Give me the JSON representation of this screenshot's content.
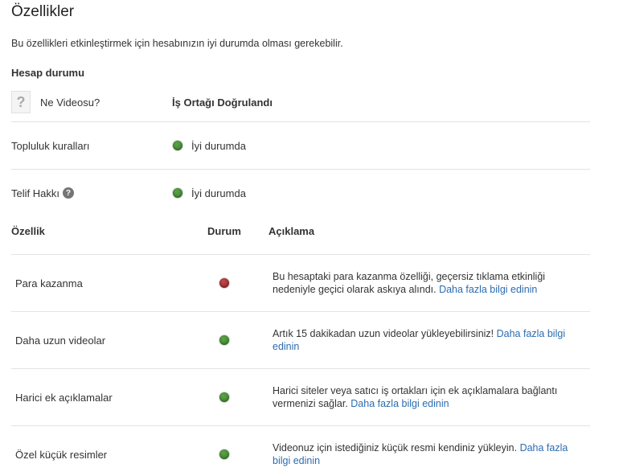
{
  "page": {
    "title": "Özellikler",
    "intro": "Bu özellikleri etkinleştirmek için hesabınızın iyi durumda olması gerekebilir."
  },
  "account_status": {
    "title": "Hesap durumu",
    "rows": [
      {
        "label": "Ne Videosu?",
        "value": "İş Ortağı Doğrulandı"
      },
      {
        "label": "Topluluk kuralları",
        "value": "İyi durumda",
        "status_color": "#3a8a2e"
      },
      {
        "label": "Telif Hakkı",
        "value": "İyi durumda",
        "status_color": "#3a8a2e"
      }
    ]
  },
  "features_table": {
    "headers": {
      "feature": "Özellik",
      "status": "Durum",
      "description": "Açıklama"
    },
    "rows": [
      {
        "name": "Para kazanma",
        "status": "red",
        "text": "Bu hesaptaki para kazanma özelliği, geçersiz tıklama etkinliği nedeniyle geçici olarak askıya alındı.",
        "link": "Daha fazla bilgi edinin"
      },
      {
        "name": "Daha uzun videolar",
        "status": "green",
        "text": "Artık 15 dakikadan uzun videolar yükleyebilirsiniz!",
        "link": "Daha fazla bilgi edinin"
      },
      {
        "name": "Harici ek açıklamalar",
        "status": "green",
        "text": "Harici siteler veya satıcı iş ortakları için ek açıklamalara bağlantı vermenizi sağlar.",
        "link": "Daha fazla bilgi edinin"
      },
      {
        "name": "Özel küçük resimler",
        "status": "green",
        "text": "Videonuz için istediğiniz küçük resmi kendiniz yükleyin.",
        "link": "Daha fazla bilgi edinin"
      }
    ]
  },
  "colors": {
    "link": "#2b6cb0",
    "status_green": "#3a8a2e",
    "status_red": "#8a1f1f",
    "divider": "#e3e3e3"
  }
}
